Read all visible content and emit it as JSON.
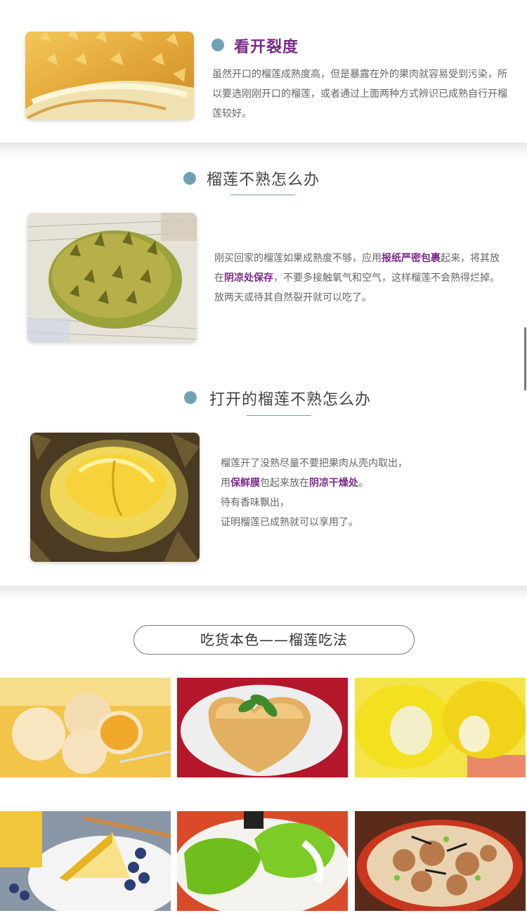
{
  "section_open": {
    "title": "看开裂度",
    "text": "虽然开口的榴莲成熟度高，但是暴露在外的果肉就容易受到污染，所以要选刚刚开口的榴莲，或者通过上面两种方式辨识已成熟自行开榴莲较好。",
    "image_label": "durian-opened-photo"
  },
  "section_unripe": {
    "title": "榴莲不熟怎么办",
    "text_before_1": "刚买回家的榴莲如果成熟度不够，应用",
    "highlight_1": "报纸严密包裹",
    "text_after_1": "起来，将其放在",
    "highlight_2": "阴凉处保存",
    "text_after_2": "，不要多接触氧气和空气，这样榴莲不会熟得烂掉。放两天或待其自然裂开就可以吃了。"
  },
  "section_opened_unripe": {
    "title": "打开的榴莲不熟怎么办",
    "line1": "榴莲开了没熟尽量不要把果肉从壳内取出，",
    "line2_pre": "用",
    "line2_hl1": "保鲜膜",
    "line2_mid": "包起来放在",
    "line2_hl2": "阴凉干燥处",
    "line2_post": "。",
    "line3": "待有香味飘出，",
    "line4": "证明榴莲已成熟就可以享用了。"
  },
  "foodie": {
    "banner": "吃货本色——榴莲吃法",
    "dishes": [
      "durian-mochi",
      "durian-heart-cake",
      "durian-pastry-roll",
      "durian-mille-crepe",
      "durian-pancake",
      "durian-chicken-hotpot"
    ]
  },
  "colors": {
    "accent_dot": "#6fa1b4",
    "highlight_purple": "#7b2a8a"
  }
}
